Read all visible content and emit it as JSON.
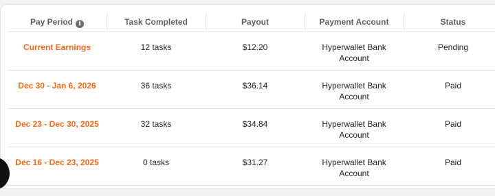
{
  "table": {
    "headers": {
      "pay_period": "Pay Period",
      "tasks": "Task Completed",
      "payout": "Payout",
      "account": "Payment Account",
      "status": "Status"
    },
    "rows": [
      {
        "period": "Current Earnings",
        "tasks": "12 tasks",
        "payout": "$12.20",
        "account": "Hyperwallet Bank Account",
        "status": "Pending"
      },
      {
        "period": "Dec 30 - Jan 6, 2026",
        "tasks": "36 tasks",
        "payout": "$36.14",
        "account": "Hyperwallet Bank Account",
        "status": "Paid"
      },
      {
        "period": "Dec 23 - Dec 30, 2025",
        "tasks": "32 tasks",
        "payout": "$34.84",
        "account": "Hyperwallet Bank Account",
        "status": "Paid"
      },
      {
        "period": "Dec 16 - Dec 23, 2025",
        "tasks": "0 tasks",
        "payout": "$31.27",
        "account": "Hyperwallet Bank Account",
        "status": "Paid"
      }
    ]
  },
  "icons": {
    "info": "info-icon"
  },
  "colors": {
    "accent": "#f26a1b",
    "header_text": "#5e5e66",
    "border": "#e4e4e7"
  }
}
